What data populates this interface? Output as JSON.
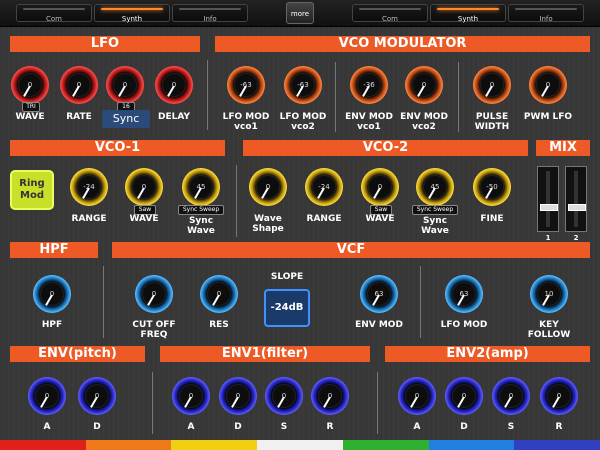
{
  "topbar": {
    "left_tabs": [
      "Com",
      "Synth",
      "Info"
    ],
    "right_tabs": [
      "Com",
      "Synth",
      "Info"
    ],
    "active": "Synth",
    "more": "more"
  },
  "sections": {
    "lfo": "LFO",
    "vco_mod": "VCO MODULATOR",
    "vco1": "VCO-1",
    "vco2": "VCO-2",
    "mix": "MIX",
    "hpf": "HPF",
    "vcf": "VCF",
    "env_pitch": "ENV(pitch)",
    "env1": "ENV1(filter)",
    "env2": "ENV2(amp)"
  },
  "lfo": {
    "wave": {
      "label": "WAVE",
      "value": "0",
      "sub": "TRI"
    },
    "rate": {
      "label": "RATE",
      "value": "0"
    },
    "sync": {
      "value": "0",
      "sub": "16",
      "button": "Sync"
    },
    "delay": {
      "label": "DELAY",
      "value": "0"
    }
  },
  "vco_mod": {
    "lfo_mod_vco1": {
      "label1": "LFO MOD",
      "label2": "vco1",
      "value": "-63"
    },
    "lfo_mod_vco2": {
      "label1": "LFO MOD",
      "label2": "vco2",
      "value": "-63"
    },
    "env_mod_vco1": {
      "label1": "ENV MOD",
      "label2": "vco1",
      "value": "-36"
    },
    "env_mod_vco2": {
      "label1": "ENV MOD",
      "label2": "vco2",
      "value": "0"
    },
    "pulse_width": {
      "label1": "PULSE",
      "label2": "WIDTH",
      "value": "0"
    },
    "pwm_lfo": {
      "label1": "PWM LFO",
      "label2": "",
      "value": "0"
    }
  },
  "vco1": {
    "ringmod": {
      "line1": "Ring",
      "line2": "Mod"
    },
    "range": {
      "label": "RANGE",
      "value": "-24"
    },
    "wave": {
      "label": "WAVE",
      "value": "0",
      "sub": "Saw"
    },
    "sync_wave": {
      "label1": "Sync",
      "label2": "Wave",
      "value": "45",
      "sub": "Sync Sweep"
    }
  },
  "vco2": {
    "wave_shape": {
      "label1": "Wave",
      "label2": "Shape",
      "value": "0"
    },
    "range": {
      "label": "RANGE",
      "value": "-24"
    },
    "wave": {
      "label": "WAVE",
      "value": "0",
      "sub": "Saw"
    },
    "sync_wave": {
      "label1": "Sync",
      "label2": "Wave",
      "value": "45",
      "sub": "Sync Sweep"
    },
    "fine": {
      "label": "FINE",
      "value": "-50"
    }
  },
  "mix": {
    "ch1": "1",
    "ch2": "2",
    "level1": 0.35,
    "level2": 0.35
  },
  "hpf": {
    "label": "HPF",
    "value": "0"
  },
  "vcf": {
    "cutoff": {
      "label1": "CUT OFF",
      "label2": "FREQ",
      "value": "0"
    },
    "res": {
      "label": "RES",
      "value": "0"
    },
    "slope": {
      "label": "SLOPE",
      "button": "-24dB"
    },
    "env_mod": {
      "label": "ENV MOD",
      "value": "63"
    },
    "lfo_mod": {
      "label": "LFO MOD",
      "value": "63"
    },
    "key_follow": {
      "label1": "KEY",
      "label2": "FOLLOW",
      "value": "10"
    }
  },
  "env_pitch": {
    "a": {
      "label": "A",
      "value": "0"
    },
    "d": {
      "label": "D",
      "value": "0"
    }
  },
  "env1": {
    "a": {
      "label": "A",
      "value": "0"
    },
    "d": {
      "label": "D",
      "value": "0"
    },
    "s": {
      "label": "S",
      "value": "0"
    },
    "r": {
      "label": "R",
      "value": "0"
    }
  },
  "env2": {
    "a": {
      "label": "A",
      "value": "0"
    },
    "d": {
      "label": "D",
      "value": "0"
    },
    "s": {
      "label": "S",
      "value": "0"
    },
    "r": {
      "label": "R",
      "value": "0"
    }
  },
  "colors": {
    "banner": "#ee5a26",
    "rainbow": [
      "#e0201a",
      "#f07a1a",
      "#f0d010",
      "#f0f0f0",
      "#30b030",
      "#2080e0",
      "#3040c0"
    ]
  }
}
